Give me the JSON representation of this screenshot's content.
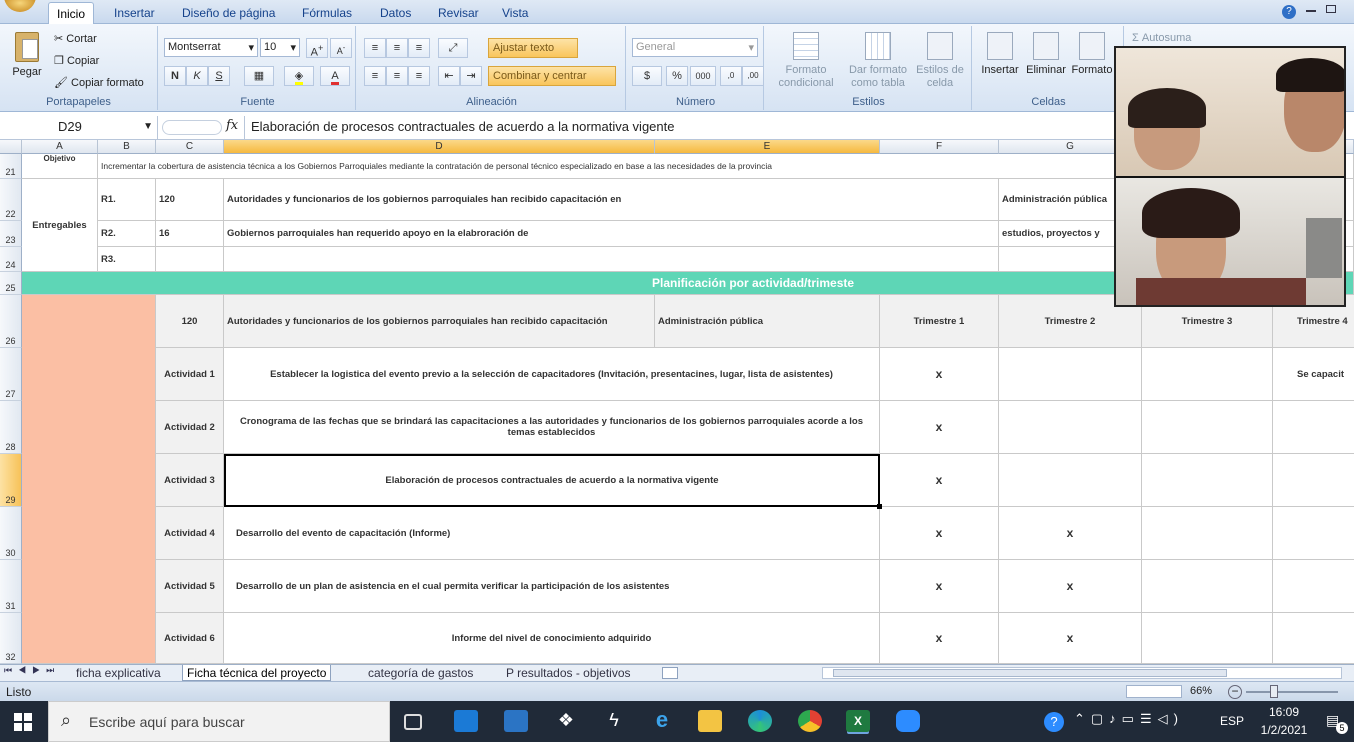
{
  "ribbon": {
    "tabs": [
      "Inicio",
      "Insertar",
      "Diseño de página",
      "Fórmulas",
      "Datos",
      "Revisar",
      "Vista"
    ],
    "clipboard": {
      "paste": "Pegar",
      "cut": "Cortar",
      "copy": "Copiar",
      "format_painter": "Copiar formato",
      "label": "Portapapeles"
    },
    "font": {
      "name": "Montserrat",
      "size": "10",
      "bold": "N",
      "italic": "K",
      "underline": "S",
      "label": "Fuente"
    },
    "alignment": {
      "wrap": "Ajustar texto",
      "merge": "Combinar y centrar",
      "label": "Alineación"
    },
    "number": {
      "format": "General",
      "currency": "$",
      "percent": "%",
      "thousands": "000",
      "label": "Número"
    },
    "styles": {
      "conditional_1": "Formato",
      "conditional_2": "condicional",
      "table_1": "Dar formato",
      "table_2": "como tabla",
      "cell_1": "Estilos de",
      "cell_2": "celda",
      "label": "Estilos"
    },
    "cells": {
      "insert": "Insertar",
      "delete": "Eliminar",
      "format": "Formato",
      "label": "Celdas"
    },
    "editing": {
      "autosum": "Σ Autosuma"
    }
  },
  "formula_bar": {
    "name_box": "D29",
    "fx": "fx",
    "content": "Elaboración de procesos contractuales de acuerdo a la normativa vigente"
  },
  "columns": [
    "A",
    "B",
    "C",
    "D",
    "E",
    "F",
    "G"
  ],
  "rows": {
    "r21": "21",
    "r22": "22",
    "r23": "23",
    "r24": "24",
    "r25": "25",
    "r26": "26",
    "r27": "27",
    "r28": "28",
    "r29": "29",
    "r30": "30",
    "r31": "31",
    "r32": "32"
  },
  "cells": {
    "objetivo_label": "Objetivo",
    "objetivo_text": "Incrementar la cobertura de asistencia técnica a los Gobiernos Parroquiales mediante la contratación de personal técnico especializado en base a las necesidades de la provincia",
    "entregables": "Entregables",
    "r1": "R1.",
    "r1_num": "120",
    "r1_text": "Autoridades y funcionarios de los gobiernos parroquiales han recibido capacitación en",
    "r1_g": "Administración pública",
    "r2": "R2.",
    "r2_num": "16",
    "r2_text": "Gobiernos parroquiales han requerido apoyo en la elabroración de",
    "r2_g": "estudios, proyectos y",
    "r3": "R3.",
    "plan_header": "Planificación por actividad/trimeste",
    "h26_num": "120",
    "h26_text": "Autoridades y funcionarios de los gobiernos parroquiales han recibido capacitación",
    "h26_e": "Administración pública",
    "t1": "Trimestre 1",
    "t2": "Trimestre 2",
    "t3": "Trimestre 3",
    "t4": "Trimestre 4"
  },
  "activities": [
    {
      "label": "Actividad 1",
      "text": "Establecer la logistica del evento previo a la  selección de capacitadores (Invitación, presentacines, lugar, lista de asistentes)",
      "t1": "x",
      "t2": "",
      "t4": "Se capacit"
    },
    {
      "label": "Actividad 2",
      "text": "Cronograma de las fechas que se brindará las capacitaciones a las autoridades y funcionarios de los gobiernos parroquiales acorde a los temas establecidos",
      "t1": "x",
      "t2": "",
      "t4": ""
    },
    {
      "label": "Actividad 3",
      "text": "Elaboración de procesos contractuales de acuerdo a la normativa vigente",
      "t1": "x",
      "t2": "",
      "t4": ""
    },
    {
      "label": "Actividad 4",
      "text": "Desarrollo del evento de capacitación (Informe)",
      "t1": "x",
      "t2": "x",
      "t4": ""
    },
    {
      "label": "Actividad 5",
      "text": "Desarrollo de un plan de asistencia en el cual permita verificar la participación de los asistentes",
      "t1": "x",
      "t2": "x",
      "t4": ""
    },
    {
      "label": "Actividad 6",
      "text": "Informe del nivel de conocimiento adquirido",
      "t1": "x",
      "t2": "x",
      "t4": ""
    }
  ],
  "sheets": [
    "ficha explicativa",
    "Ficha técnica del proyecto",
    "categoría de gastos",
    "P resultados - objetivos"
  ],
  "status": {
    "ready": "Listo",
    "zoom": "66%"
  },
  "taskbar": {
    "search": "Escribe aquí para buscar",
    "lang": "ESP",
    "time": "16:09",
    "date": "1/2/2021",
    "notif": "5"
  },
  "colors": {
    "teal": "#5ed6b6",
    "salmon": "#fbbfa4",
    "accent": "#1e5fb4"
  }
}
